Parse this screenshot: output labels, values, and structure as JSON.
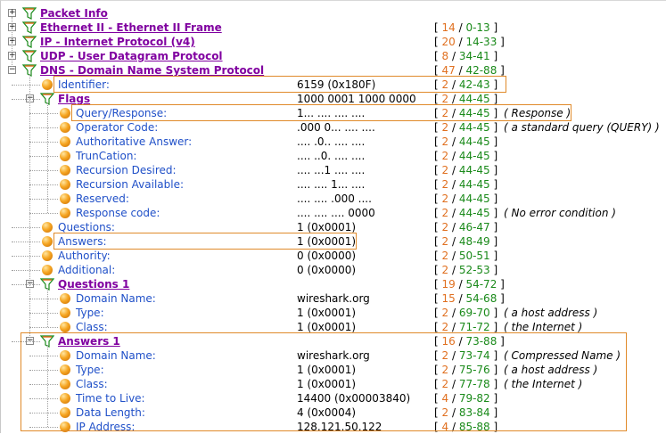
{
  "rows": [
    {
      "depth": 0,
      "exp": "+",
      "icon": "filter",
      "bold": true,
      "label": "Packet Info",
      "value": "",
      "offset": null,
      "note": ""
    },
    {
      "depth": 0,
      "exp": "+",
      "icon": "filter",
      "bold": true,
      "label": "Ethernet II - Ethernet II Frame",
      "value": "",
      "offset": {
        "len": "14",
        "range": "0-13"
      },
      "note": ""
    },
    {
      "depth": 0,
      "exp": "+",
      "icon": "filter",
      "bold": true,
      "label": "IP - Internet Protocol (v4)",
      "value": "",
      "offset": {
        "len": "20",
        "range": "14-33"
      },
      "note": ""
    },
    {
      "depth": 0,
      "exp": "+",
      "icon": "filter",
      "bold": true,
      "label": "UDP - User Datagram Protocol",
      "value": "",
      "offset": {
        "len": "8",
        "range": "34-41"
      },
      "note": ""
    },
    {
      "depth": 0,
      "exp": "-",
      "icon": "filter",
      "bold": true,
      "label": "DNS - Domain Name System Protocol",
      "value": "",
      "offset": {
        "len": "47",
        "range": "42-88"
      },
      "note": ""
    },
    {
      "depth": 1,
      "exp": "",
      "icon": "ball",
      "bold": false,
      "label": "Identifier:",
      "value": "6159 (0x180F)",
      "offset": {
        "len": "2",
        "range": "42-43"
      },
      "note": ""
    },
    {
      "depth": 1,
      "exp": "-",
      "icon": "filter",
      "bold": true,
      "label": "Flags",
      "value": "1000 0001 1000 0000",
      "offset": {
        "len": "2",
        "range": "44-45"
      },
      "note": ""
    },
    {
      "depth": 2,
      "exp": "",
      "icon": "ball",
      "bold": false,
      "label": "Query/Response:",
      "value": "1... .... .... ....",
      "offset": {
        "len": "2",
        "range": "44-45"
      },
      "note": "( Response )"
    },
    {
      "depth": 2,
      "exp": "",
      "icon": "ball",
      "bold": false,
      "label": "Operator Code:",
      "value": ".000 0... .... ....",
      "offset": {
        "len": "2",
        "range": "44-45"
      },
      "note": "( a standard query (QUERY) )"
    },
    {
      "depth": 2,
      "exp": "",
      "icon": "ball",
      "bold": false,
      "label": "Authoritative Answer:",
      "value": ".... .0.. .... ....",
      "offset": {
        "len": "2",
        "range": "44-45"
      },
      "note": ""
    },
    {
      "depth": 2,
      "exp": "",
      "icon": "ball",
      "bold": false,
      "label": "TrunCation:",
      "value": ".... ..0. .... ....",
      "offset": {
        "len": "2",
        "range": "44-45"
      },
      "note": ""
    },
    {
      "depth": 2,
      "exp": "",
      "icon": "ball",
      "bold": false,
      "label": "Recursion Desired:",
      "value": ".... ...1 .... ....",
      "offset": {
        "len": "2",
        "range": "44-45"
      },
      "note": ""
    },
    {
      "depth": 2,
      "exp": "",
      "icon": "ball",
      "bold": false,
      "label": "Recursion Available:",
      "value": ".... .... 1... ....",
      "offset": {
        "len": "2",
        "range": "44-45"
      },
      "note": ""
    },
    {
      "depth": 2,
      "exp": "",
      "icon": "ball",
      "bold": false,
      "label": "Reserved:",
      "value": ".... .... .000 ....",
      "offset": {
        "len": "2",
        "range": "44-45"
      },
      "note": ""
    },
    {
      "depth": 2,
      "exp": "",
      "icon": "ball",
      "bold": false,
      "label": "Response code:",
      "value": ".... .... .... 0000",
      "offset": {
        "len": "2",
        "range": "44-45"
      },
      "note": "( No error condition )"
    },
    {
      "depth": 1,
      "exp": "",
      "icon": "ball",
      "bold": false,
      "label": "Questions:",
      "value": "1 (0x0001)",
      "offset": {
        "len": "2",
        "range": "46-47"
      },
      "note": ""
    },
    {
      "depth": 1,
      "exp": "",
      "icon": "ball",
      "bold": false,
      "label": "Answers:",
      "value": "1 (0x0001)",
      "offset": {
        "len": "2",
        "range": "48-49"
      },
      "note": ""
    },
    {
      "depth": 1,
      "exp": "",
      "icon": "ball",
      "bold": false,
      "label": "Authority:",
      "value": "0 (0x0000)",
      "offset": {
        "len": "2",
        "range": "50-51"
      },
      "note": ""
    },
    {
      "depth": 1,
      "exp": "",
      "icon": "ball",
      "bold": false,
      "label": "Additional:",
      "value": "0 (0x0000)",
      "offset": {
        "len": "2",
        "range": "52-53"
      },
      "note": ""
    },
    {
      "depth": 1,
      "exp": "-",
      "icon": "filter",
      "bold": true,
      "label": "Questions 1",
      "value": "",
      "offset": {
        "len": "19",
        "range": "54-72"
      },
      "note": ""
    },
    {
      "depth": 2,
      "exp": "",
      "icon": "ball",
      "bold": false,
      "label": "Domain Name:",
      "value": "wireshark.org",
      "offset": {
        "len": "15",
        "range": "54-68"
      },
      "note": ""
    },
    {
      "depth": 2,
      "exp": "",
      "icon": "ball",
      "bold": false,
      "label": "Type:",
      "value": "1 (0x0001)",
      "offset": {
        "len": "2",
        "range": "69-70"
      },
      "note": "( a host address )"
    },
    {
      "depth": 2,
      "exp": "",
      "icon": "ball",
      "bold": false,
      "label": "Class:",
      "value": "1 (0x0001)",
      "offset": {
        "len": "2",
        "range": "71-72"
      },
      "note": "( the Internet )"
    },
    {
      "depth": 1,
      "exp": "-",
      "icon": "filter",
      "bold": true,
      "label": "Answers 1",
      "value": "",
      "offset": {
        "len": "16",
        "range": "73-88"
      },
      "note": ""
    },
    {
      "depth": 2,
      "exp": "",
      "icon": "ball",
      "bold": false,
      "label": "Domain Name:",
      "value": "wireshark.org",
      "offset": {
        "len": "2",
        "range": "73-74"
      },
      "note": "( Compressed Name )"
    },
    {
      "depth": 2,
      "exp": "",
      "icon": "ball",
      "bold": false,
      "label": "Type:",
      "value": "1 (0x0001)",
      "offset": {
        "len": "2",
        "range": "75-76"
      },
      "note": "( a host address )"
    },
    {
      "depth": 2,
      "exp": "",
      "icon": "ball",
      "bold": false,
      "label": "Class:",
      "value": "1 (0x0001)",
      "offset": {
        "len": "2",
        "range": "77-78"
      },
      "note": "( the Internet )"
    },
    {
      "depth": 2,
      "exp": "",
      "icon": "ball",
      "bold": false,
      "label": "Time to Live:",
      "value": "14400 (0x00003840)",
      "offset": {
        "len": "4",
        "range": "79-82"
      },
      "note": ""
    },
    {
      "depth": 2,
      "exp": "",
      "icon": "ball",
      "bold": false,
      "label": "Data Length:",
      "value": "4 (0x0004)",
      "offset": {
        "len": "2",
        "range": "83-84"
      },
      "note": ""
    },
    {
      "depth": 2,
      "exp": "",
      "icon": "ball",
      "bold": false,
      "label": "IP Address:",
      "value": "128.121.50.122",
      "offset": {
        "len": "4",
        "range": "85-88"
      },
      "note": ""
    }
  ],
  "colors": {
    "highlight": "#e08a2a",
    "section": "#8000a0",
    "field": "#2050c8",
    "len": "#e07020",
    "range": "#1a8a1a"
  }
}
